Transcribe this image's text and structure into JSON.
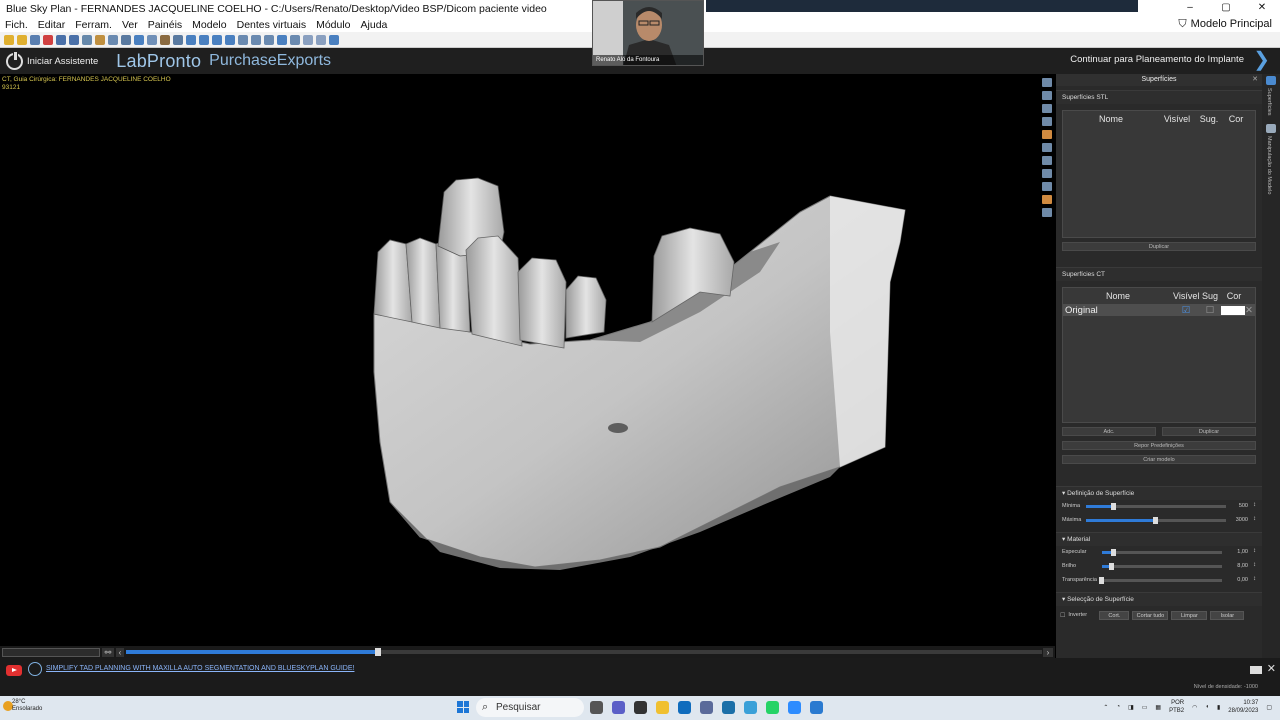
{
  "window": {
    "title": "Blue Sky Plan - FERNANDES JACQUELINE COELHO - C:/Users/Renato/Desktop/Video BSP/Dicom paciente video",
    "minimize": "–",
    "maximize": "▢",
    "close": "✕"
  },
  "menu": {
    "items": [
      "Fich.",
      "Editar",
      "Ferram.",
      "Ver",
      "Painéis",
      "Modelo",
      "Dentes virtuais",
      "Módulo",
      "Ajuda"
    ],
    "model_label": "Modelo Principal"
  },
  "assist": {
    "start_label": "Iniciar Assistente",
    "labpronto": "LabPronto",
    "purchase": "PurchaseExports",
    "continue_label": "Continuar para Planeamento do Implante"
  },
  "viewport": {
    "info_line1": "CT, Guia Cirúrgica: FERNANDES JACQUELINE COELHO",
    "info_line2": "93121"
  },
  "timeline": {
    "progress": 0.275
  },
  "webcam": {
    "caption": "Renato Aló da Fontoura"
  },
  "panel": {
    "title": "Superfícies",
    "stl_section": "Superfícies STL",
    "stl_headers": [
      "Nome",
      "Visível",
      "Sug.",
      "Cor"
    ],
    "stl_button": "Duplicar",
    "ct_section": "Superfícies CT",
    "ct_headers": [
      "Nome",
      "Visível",
      "Sug",
      "Cor"
    ],
    "ct_rows": [
      {
        "name": "Original",
        "visible": true,
        "color": "#ffffff"
      }
    ],
    "ct_buttons": {
      "add": "Adc.",
      "duplicate": "Duplicar",
      "reset": "Repor Predefinições",
      "create": "Criar modelo"
    },
    "def_section": "Definição de Superfície",
    "min_label": "Mínima",
    "min_value": "500",
    "min_fraction": 0.2,
    "max_label": "Máxima",
    "max_value": "3000",
    "max_fraction": 0.5,
    "material_section": "Material",
    "spec_label": "Especular",
    "spec_value": "1,00",
    "spec_fraction": 0.1,
    "bright_label": "Brilho",
    "bright_value": "8,00",
    "bright_fraction": 0.08,
    "transp_label": "Transparência",
    "transp_value": "0,00",
    "transp_fraction": 0.0,
    "select_section": "Selecção de Superfície",
    "invert_label": "Inverter",
    "cut_label": "Cort.",
    "cut_all_label": "Cortar tudo",
    "clear_label": "Limpar",
    "isolate_label": "Isolar"
  },
  "side_tabs": [
    "Superfícies",
    "Manipulação do Modelo"
  ],
  "bottom": {
    "link": "SIMPLIFY TAD PLANNING WITH MAXILLA AUTO SEGMENTATION AND BLUESKYPLAN GUIDE!",
    "density": "Nível de densidade: -1000"
  },
  "taskbar": {
    "temp": "28°C",
    "weather": "Ensolarado",
    "search": "Pesquisar",
    "lang1": "POR",
    "lang2": "PTB2",
    "time": "10:37",
    "date": "28/09/2023"
  },
  "colors": {
    "accent": "#2f7bd8",
    "panel_bg": "#2a2a2a",
    "link": "#8ab4f8"
  }
}
